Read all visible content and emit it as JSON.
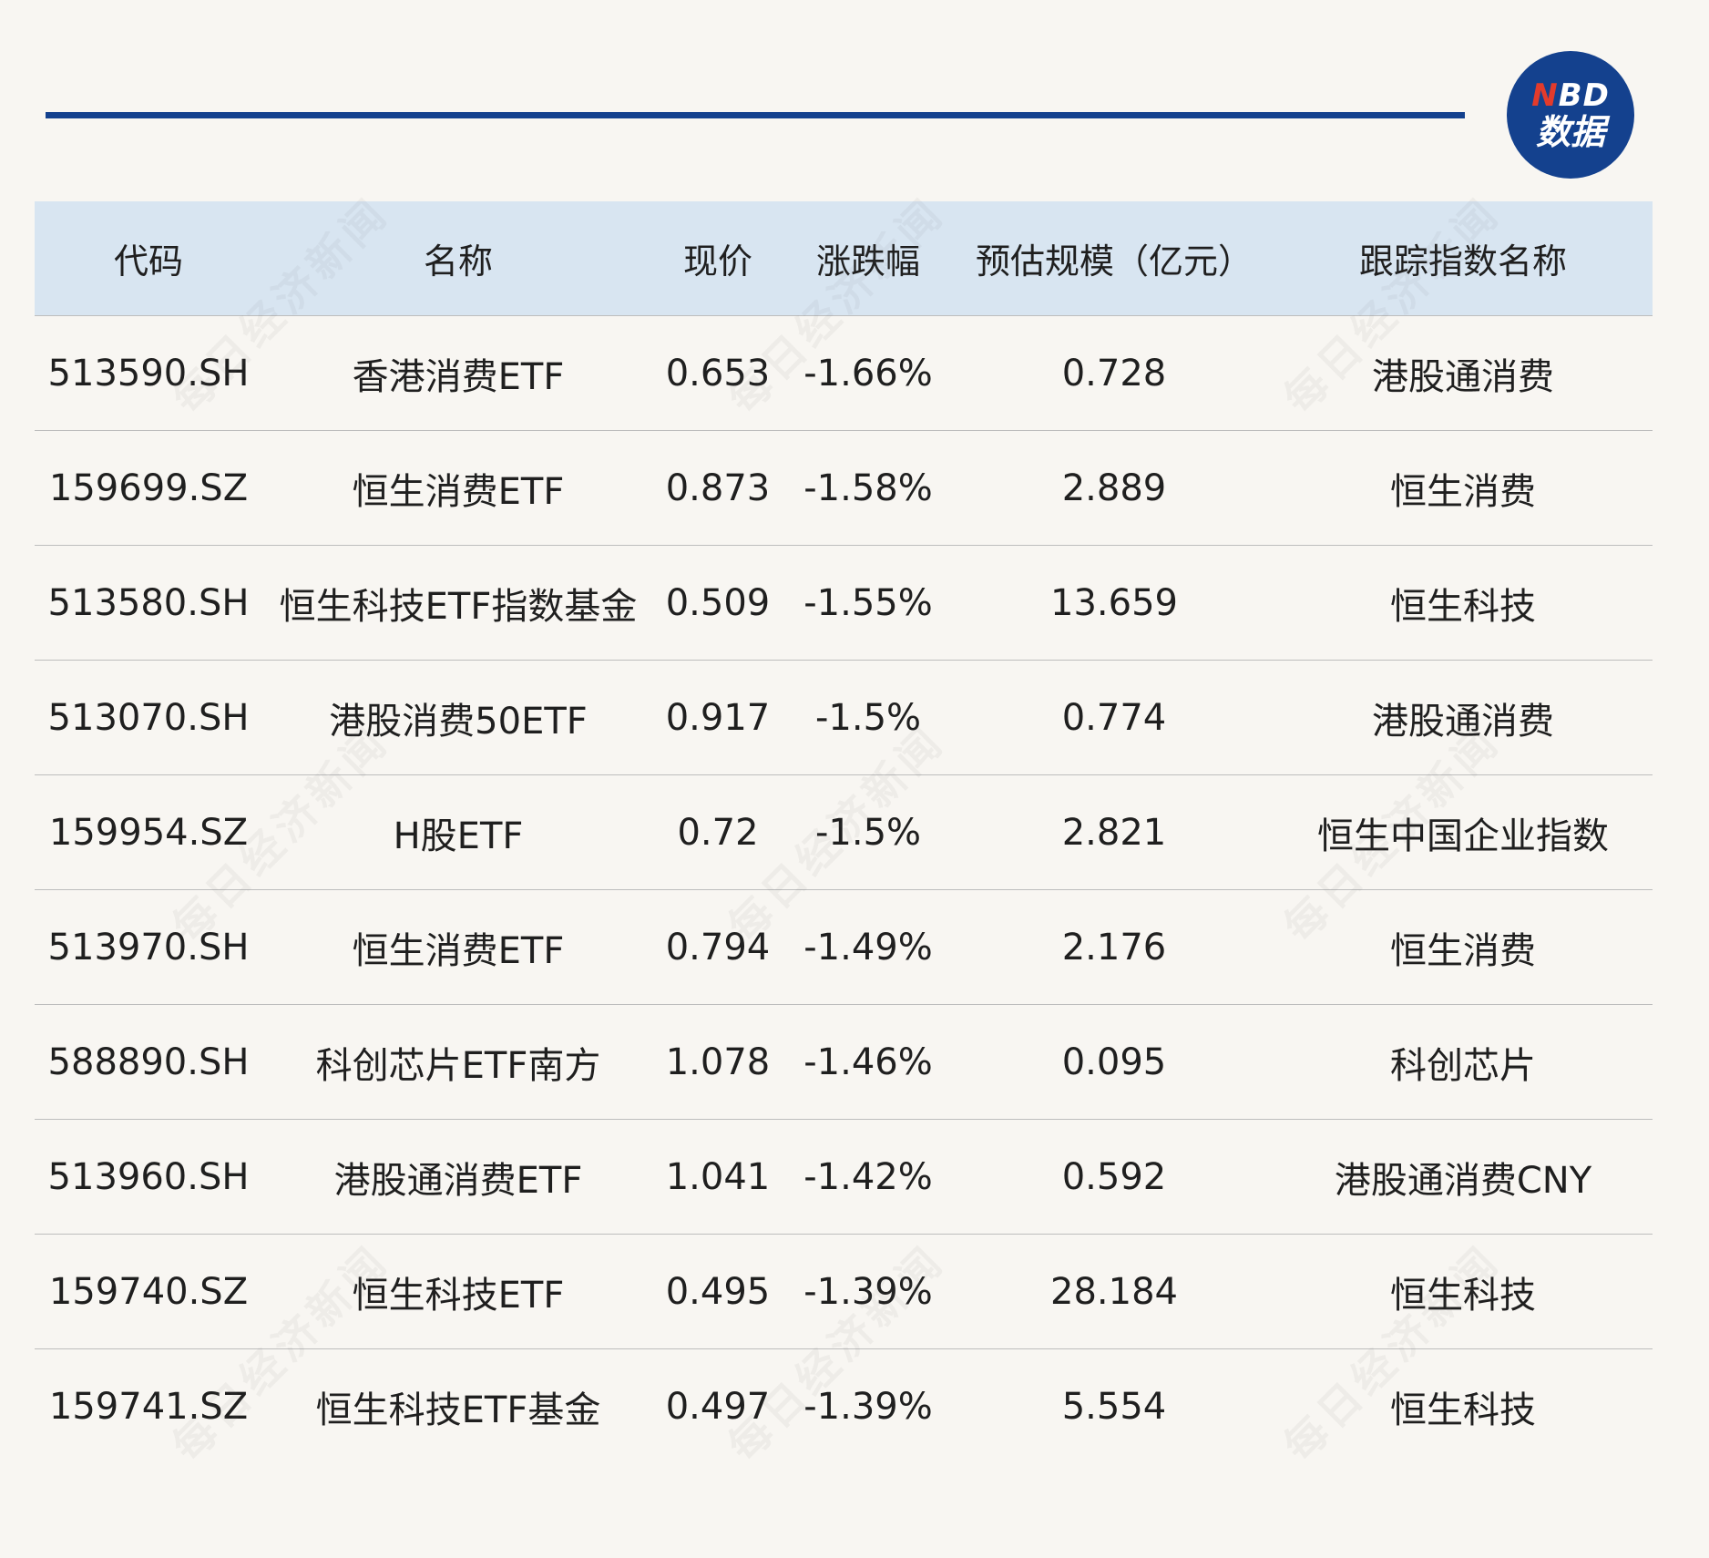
{
  "logo": {
    "line1_accent": "N",
    "line1_rest": "BD",
    "line2": "数据"
  },
  "watermark_text": "每日经济新闻",
  "table": {
    "headers": [
      "代码",
      "名称",
      "现价",
      "涨跌幅",
      "预估规模（亿元）",
      "跟踪指数名称"
    ],
    "rows": [
      [
        "513590.SH",
        "香港消费ETF",
        "0.653",
        "-1.66%",
        "0.728",
        "港股通消费"
      ],
      [
        "159699.SZ",
        "恒生消费ETF",
        "0.873",
        "-1.58%",
        "2.889",
        "恒生消费"
      ],
      [
        "513580.SH",
        "恒生科技ETF指数基金",
        "0.509",
        "-1.55%",
        "13.659",
        "恒生科技"
      ],
      [
        "513070.SH",
        "港股消费50ETF",
        "0.917",
        "-1.5%",
        "0.774",
        "港股通消费"
      ],
      [
        "159954.SZ",
        "H股ETF",
        "0.72",
        "-1.5%",
        "2.821",
        "恒生中国企业指数"
      ],
      [
        "513970.SH",
        "恒生消费ETF",
        "0.794",
        "-1.49%",
        "2.176",
        "恒生消费"
      ],
      [
        "588890.SH",
        "科创芯片ETF南方",
        "1.078",
        "-1.46%",
        "0.095",
        "科创芯片"
      ],
      [
        "513960.SH",
        "港股通消费ETF",
        "1.041",
        "-1.42%",
        "0.592",
        "港股通消费CNY"
      ],
      [
        "159740.SZ",
        "恒生科技ETF",
        "0.495",
        "-1.39%",
        "28.184",
        "恒生科技"
      ],
      [
        "159741.SZ",
        "恒生科技ETF基金",
        "0.497",
        "-1.39%",
        "5.554",
        "恒生科技"
      ]
    ]
  }
}
